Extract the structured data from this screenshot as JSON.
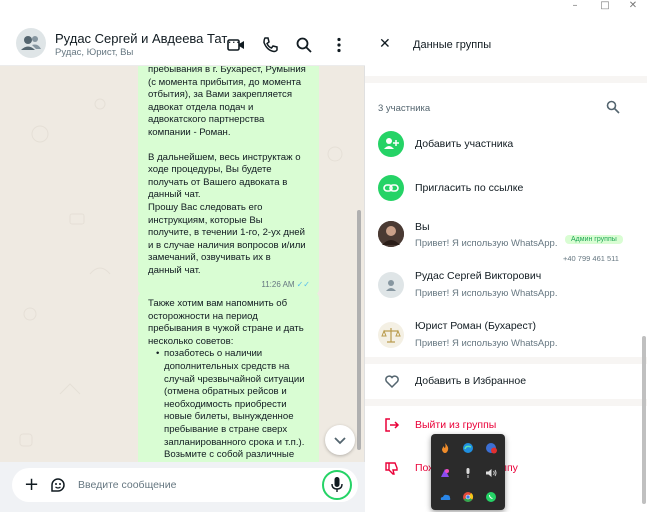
{
  "window": {
    "minimize": "–",
    "maximize": "□",
    "close": "✕"
  },
  "chat": {
    "title": "Рудас Сергей и Авдеева Тат…",
    "subtitle": "Рудас, Юрист, Вы",
    "messages": [
      {
        "lines": [
          "пребывания в г. Бухарест, Румыния",
          "(с момента прибытия, до момента",
          "отбытия), за Вами закрепляется",
          "адвокат отдела подач и",
          "адвокатского партнерства",
          "компании - Роман.",
          "",
          "В дальнейшем, весь инструктаж о",
          "ходе процедуры, Вы будете",
          "получать от Вашего адвоката в",
          "данный чат.",
          "Прошу Вас следовать его",
          "инструкциям, которые Вы",
          "получите, в течении 1-го, 2-ух дней",
          "и в случае наличия вопросов и/или",
          "замечаний, озвучивать их в",
          "данный чат."
        ],
        "time": "11:26 AM"
      },
      {
        "lines": [
          "Также хотим вам напомнить об",
          "осторожности на период",
          "пребывания в чужой стране и дать",
          "несколько советов:"
        ],
        "bullet_lines": [
          "позаботесь о наличии",
          "дополнительных средств на",
          "случай чрезвычайной ситуации",
          "(отмена обратных рейсов и",
          "необходимость приобрести",
          "новые билеты, вынужденное",
          "пребывание в стране сверх",
          "запланированного срока и т.п.).",
          "Возьмите с собой различные"
        ]
      }
    ],
    "input_placeholder": "Введите сообщение"
  },
  "group_info": {
    "title": "Данные группы",
    "members_count": "3 участника",
    "actions": {
      "add_member": "Добавить участника",
      "invite_link": "Пригласить по ссылке"
    },
    "members": [
      {
        "name": "Вы",
        "status": "Привет! Я использую WhatsApp.",
        "badge": "Админ группы",
        "phone": "+40 799 461 511"
      },
      {
        "name": "Рудас Сергей Викторович",
        "status": "Привет! Я использую WhatsApp."
      },
      {
        "name": "Юрист Роман (Бухарест)",
        "status": "Привет! Я использую WhatsApp."
      }
    ],
    "favorites": "Добавить в Избранное",
    "exit_group": "Выйти из группы",
    "report_group_start": "Пож",
    "report_group_end": "руппу"
  },
  "colors": {
    "accent": "#25d366",
    "bubble": "#d9fdd3",
    "danger": "#ea0038",
    "chat_bg": "#efeae2"
  }
}
